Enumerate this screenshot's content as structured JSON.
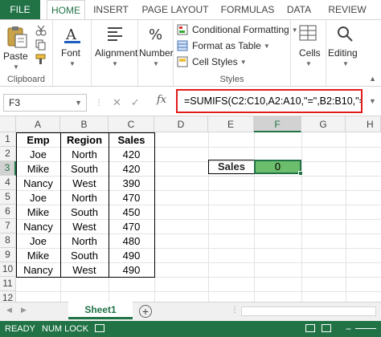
{
  "ribbon_tabs": [
    "FILE",
    "HOME",
    "INSERT",
    "PAGE LAYOUT",
    "FORMULAS",
    "DATA",
    "REVIEW"
  ],
  "groups": {
    "clipboard": {
      "paste": "Paste",
      "label": "Clipboard"
    },
    "font": {
      "label": "Font"
    },
    "alignment": {
      "label": "Alignment"
    },
    "number": {
      "label": "Number"
    },
    "styles": {
      "conditional": "Conditional Formatting",
      "format_table": "Format as Table",
      "cell_styles": "Cell Styles",
      "label": "Styles"
    },
    "cells": {
      "label": "Cells"
    },
    "editing": {
      "label": "Editing"
    }
  },
  "formula_bar": {
    "name_box": "F3",
    "fx": "fx",
    "formula": "=SUMIFS(C2:C10,A2:A10,\"=\",B2:B10,\"=\")"
  },
  "columns": [
    "A",
    "B",
    "C",
    "D",
    "E",
    "F",
    "G",
    "H"
  ],
  "rows": [
    "1",
    "2",
    "3",
    "4",
    "5",
    "6",
    "7",
    "8",
    "9",
    "10",
    "11",
    "12"
  ],
  "table": {
    "headers": [
      "Emp",
      "Region",
      "Sales"
    ],
    "rows": [
      [
        "Joe",
        "North",
        "420"
      ],
      [
        "Mike",
        "South",
        "420"
      ],
      [
        "Nancy",
        "West",
        "390"
      ],
      [
        "Joe",
        "North",
        "470"
      ],
      [
        "Mike",
        "South",
        "450"
      ],
      [
        "Nancy",
        "West",
        "470"
      ],
      [
        "Joe",
        "North",
        "480"
      ],
      [
        "Mike",
        "South",
        "490"
      ],
      [
        "Nancy",
        "West",
        "490"
      ]
    ]
  },
  "result": {
    "label": "Sales",
    "value": "0"
  },
  "sheet_tabs": {
    "active": "Sheet1",
    "add": "⊕"
  },
  "status": {
    "mode": "READY",
    "numlock": "NUM LOCK"
  },
  "colors": {
    "accent": "#217346",
    "highlight_border": "#e11c1c",
    "selected_fill": "#6cbd6c"
  }
}
